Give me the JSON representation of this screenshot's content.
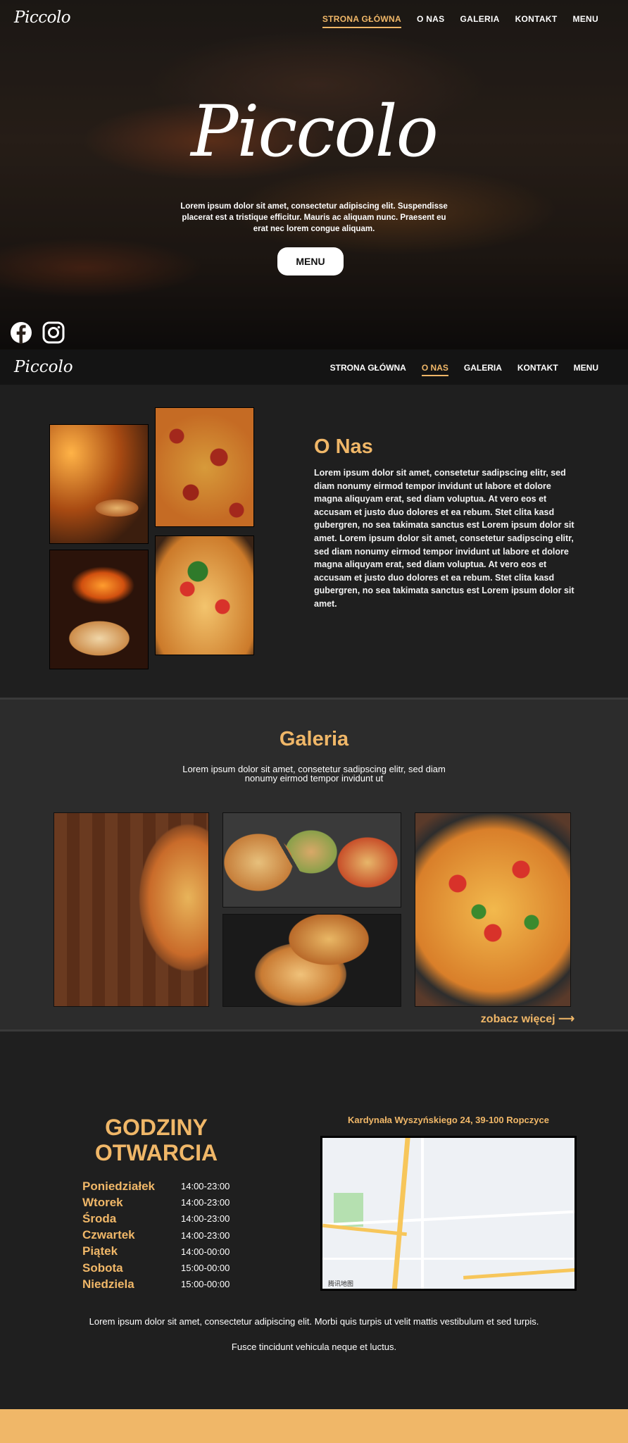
{
  "brand": {
    "logo": "Piccolo",
    "accent": "#f0b768"
  },
  "nav": {
    "items": [
      {
        "label": "STRONA GŁÓWNA",
        "active": true
      },
      {
        "label": "O NAS",
        "active": false
      },
      {
        "label": "GALERIA",
        "active": false
      },
      {
        "label": "KONTAKT",
        "active": false
      },
      {
        "label": "MENU",
        "active": false
      }
    ]
  },
  "nav_sticky": {
    "items": [
      {
        "label": "STRONA GŁÓWNA",
        "active": false
      },
      {
        "label": "O NAS",
        "active": true
      },
      {
        "label": "GALERIA",
        "active": false
      },
      {
        "label": "KONTAKT",
        "active": false
      },
      {
        "label": "MENU",
        "active": false
      }
    ]
  },
  "hero": {
    "title": "Piccolo",
    "text": "Lorem ipsum dolor sit amet, consectetur adipiscing elit. Suspendisse placerat est a tristique efficitur. Mauris ac aliquam nunc. Praesent eu erat nec lorem congue aliquam.",
    "button": "MENU",
    "socials": [
      "facebook-icon",
      "instagram-icon"
    ]
  },
  "about": {
    "title": "O Nas",
    "text": "Lorem ipsum dolor sit amet, consetetur sadipscing elitr, sed diam nonumy eirmod tempor invidunt ut labore et dolore magna aliquyam erat, sed diam voluptua. At vero eos et accusam et justo duo dolores et ea rebum. Stet clita kasd gubergren, no sea takimata sanctus est Lorem ipsum dolor sit amet. Lorem ipsum dolor sit amet, consetetur sadipscing elitr, sed diam nonumy eirmod tempor invidunt ut labore et dolore magna aliquyam erat, sed diam voluptua. At vero eos et accusam et justo duo dolores et ea rebum. Stet clita kasd gubergren, no sea takimata sanctus est Lorem ipsum dolor sit amet."
  },
  "gallery": {
    "title": "Galeria",
    "text": "Lorem ipsum dolor sit amet, consetetur sadipscing elitr, sed diam nonumy eirmod tempor invidunt ut",
    "see_more": "zobacz więcej ⟶"
  },
  "hours": {
    "title": "GODZINY OTWARCIA",
    "rows": [
      {
        "day": "Poniedziałek",
        "time": "14:00-23:00"
      },
      {
        "day": "Wtorek",
        "time": "14:00-23:00"
      },
      {
        "day": "Środa",
        "time": "14:00-23:00"
      },
      {
        "day": "Czwartek",
        "time": "14:00-23:00"
      },
      {
        "day": "Piątek",
        "time": "14:00-00:00"
      },
      {
        "day": "Sobota",
        "time": "15:00-00:00"
      },
      {
        "day": "Niedziela",
        "time": "15:00-00:00"
      }
    ],
    "address": "Kardynała Wyszyńskiego 24, 39-100 Ropczyce",
    "map_credit": "腾讯地图",
    "text": "Lorem ipsum dolor sit amet, consectetur adipiscing elit. Morbi quis turpis ut velit mattis vestibulum et sed turpis. Fusce tincidunt vehicula neque et luctus."
  }
}
